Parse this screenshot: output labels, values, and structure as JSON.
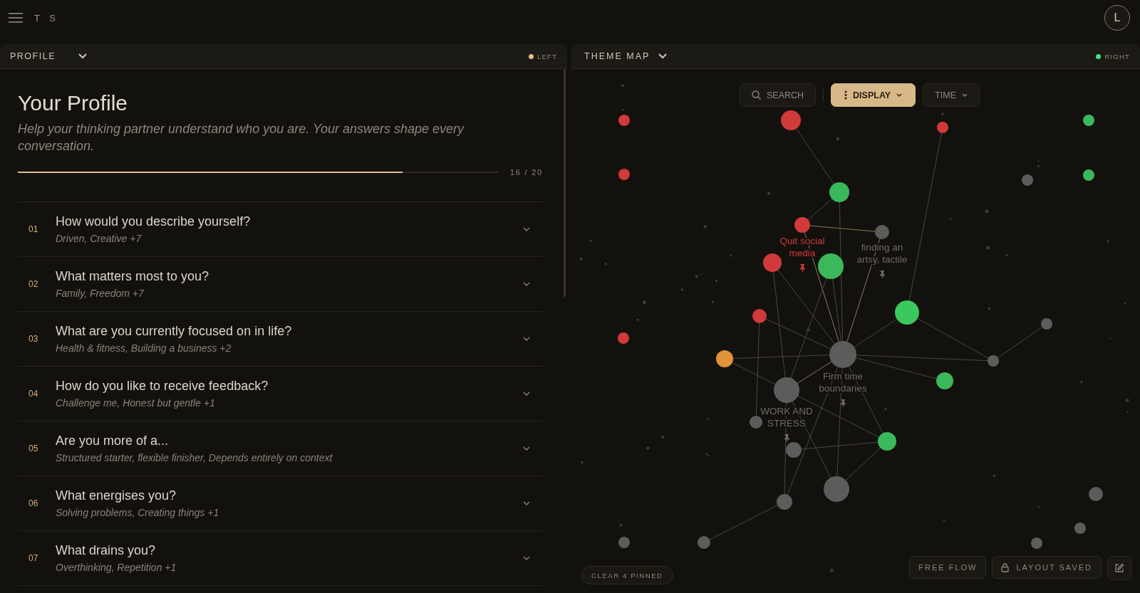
{
  "top_bar": {
    "brand": "T S",
    "avatar": "L"
  },
  "profile_panel": {
    "header": "PROFILE",
    "status": {
      "label": "LEFT",
      "color": "#e3c08a"
    },
    "title": "Your Profile",
    "subtitle": "Help your thinking partner understand who you are. Your answers shape every conversation.",
    "progress": {
      "level": 0.8,
      "reading": "16 / 20"
    },
    "questions": [
      {
        "number": "01",
        "question": "How would you describe yourself?",
        "answer": "Driven, Creative +7"
      },
      {
        "number": "02",
        "question": "What matters most to you?",
        "answer": "Family, Freedom +7"
      },
      {
        "number": "03",
        "question": "What are you currently focused on in life?",
        "answer": "Health & fitness, Building a business +2"
      },
      {
        "number": "04",
        "question": "How do you like to receive feedback?",
        "answer": "Challenge me, Honest but gentle +1"
      },
      {
        "number": "05",
        "question": "Are you more of a...",
        "answer": "Structured starter, flexible finisher, Depends entirely on context"
      },
      {
        "number": "06",
        "question": "What energises you?",
        "answer": "Solving problems, Creating things +1"
      },
      {
        "number": "07",
        "question": "What drains you?",
        "answer": "Overthinking, Repetition +1"
      }
    ]
  },
  "map_panel": {
    "header": "THEME MAP",
    "status": {
      "label": "RIGHT",
      "color": "#4ade80"
    },
    "toolbar": [
      {
        "kind": "search",
        "label": "SEARCH",
        "selected": false
      },
      {
        "kind": "menu",
        "label": "DISPLAY",
        "selected": true
      },
      {
        "kind": "dropdown",
        "label": "TIME",
        "selected": false
      }
    ],
    "nodes": [
      {
        "color": "#d13a3a"
      },
      {
        "color": "#d13a3a"
      },
      {
        "color": "#d13a3a"
      },
      {
        "color": "#3bb85c"
      },
      {
        "color": "#d13a3a"
      },
      {
        "color": "#3bb85c"
      },
      {
        "color": "#5c5c5c"
      },
      {
        "color": "#3bb85c"
      },
      {
        "color": "#d13a3a",
        "label": "Quit social media",
        "pinned": true
      },
      {
        "color": "#5c5c5c",
        "label": "finding an artsy, tactile",
        "pinned": true
      },
      {
        "color": "#d13a3a"
      },
      {
        "color": "#3bb85c"
      },
      {
        "color": "#3bc95e"
      },
      {
        "color": "#d13a3a"
      },
      {
        "color": "#d13a3a"
      },
      {
        "color": "#5c5c5c"
      },
      {
        "color": "#e0943a"
      },
      {
        "color": "#5c5c5c",
        "label": "Firm time boundaries",
        "pinned": true
      },
      {
        "color": "#5c5c5c"
      },
      {
        "color": "#3bb85c"
      },
      {
        "color": "#5c5c5c",
        "label": "WORK AND STRESS",
        "pinned": true
      },
      {
        "color": "#5c5c5c"
      },
      {
        "color": "#3bb85c"
      },
      {
        "color": "#5c5c5c"
      },
      {
        "color": "#5c5c5c"
      },
      {
        "color": "#5c5c5c"
      },
      {
        "color": "#5c5c5c"
      },
      {
        "color": "#5c5c5c"
      },
      {
        "color": "#5c5c5c"
      },
      {
        "color": "#5c5c5c"
      },
      {
        "color": "#5c5c5c"
      }
    ],
    "clear_button": "CLEAR 4 PINNED",
    "flow_button": "FREE FLOW",
    "layout_button": "LAYOUT SAVED"
  }
}
